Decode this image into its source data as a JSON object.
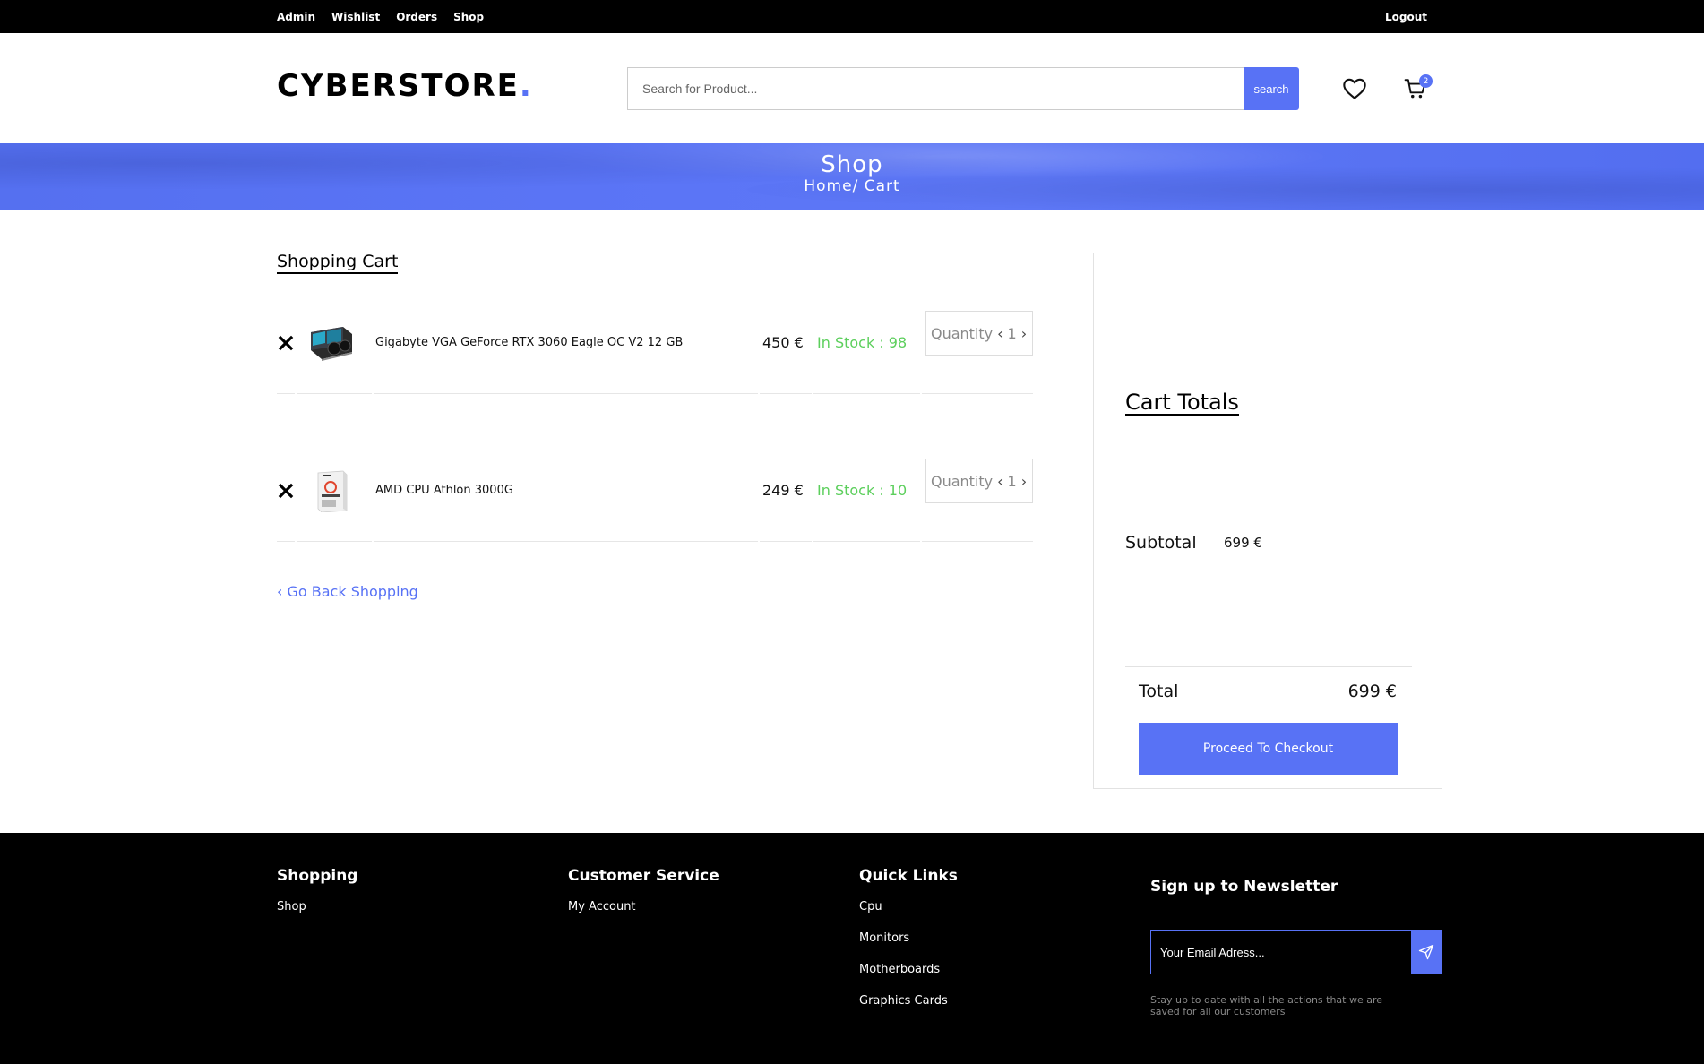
{
  "topbar": {
    "links": [
      "Admin",
      "Wishlist",
      "Orders",
      "Shop"
    ],
    "logout": "Logout"
  },
  "header": {
    "logo_text": "CYBERSTORE",
    "logo_dot": ".",
    "search_placeholder": "Search for Product...",
    "search_button": "search",
    "cart_count": "2",
    "wishlist_icon": "heart-icon",
    "cart_icon": "shopping-cart-icon"
  },
  "banner": {
    "title": "Shop",
    "breadcrumb": "Home/ Cart"
  },
  "cart": {
    "heading": "Shopping Cart",
    "items": [
      {
        "name": "Gigabyte VGA GeForce RTX 3060 Eagle OC V2 12 GB",
        "price": "450 €",
        "stock": "In Stock : 98",
        "quantity_label": "Quantity",
        "quantity": "1"
      },
      {
        "name": "AMD CPU Athlon 3000G",
        "price": "249 €",
        "stock": "In Stock : 10",
        "quantity_label": "Quantity",
        "quantity": "1"
      }
    ],
    "back_link": "Go Back Shopping"
  },
  "totals": {
    "title": "Cart Totals",
    "subtotal_label": "Subtotal",
    "subtotal_value": "699 €",
    "total_label": "Total",
    "total_value": "699 €",
    "checkout_button": "Proceed To Checkout"
  },
  "footer": {
    "shopping": {
      "title": "Shopping",
      "links": [
        "Shop"
      ]
    },
    "customer_service": {
      "title": "Customer Service",
      "links": [
        "My Account"
      ]
    },
    "quick_links": {
      "title": "Quick Links",
      "links": [
        "Cpu",
        "Monitors",
        "Motherboards",
        "Graphics Cards"
      ]
    },
    "newsletter": {
      "title": "Sign up to Newsletter",
      "placeholder": "Your Email Adress...",
      "note": "Stay up to date with all the actions that we are saved for all our customers"
    }
  },
  "colors": {
    "accent": "#5872f5",
    "in_stock": "#5ccf5c",
    "topbar_bg": "#000000",
    "footer_bg": "#000000"
  }
}
